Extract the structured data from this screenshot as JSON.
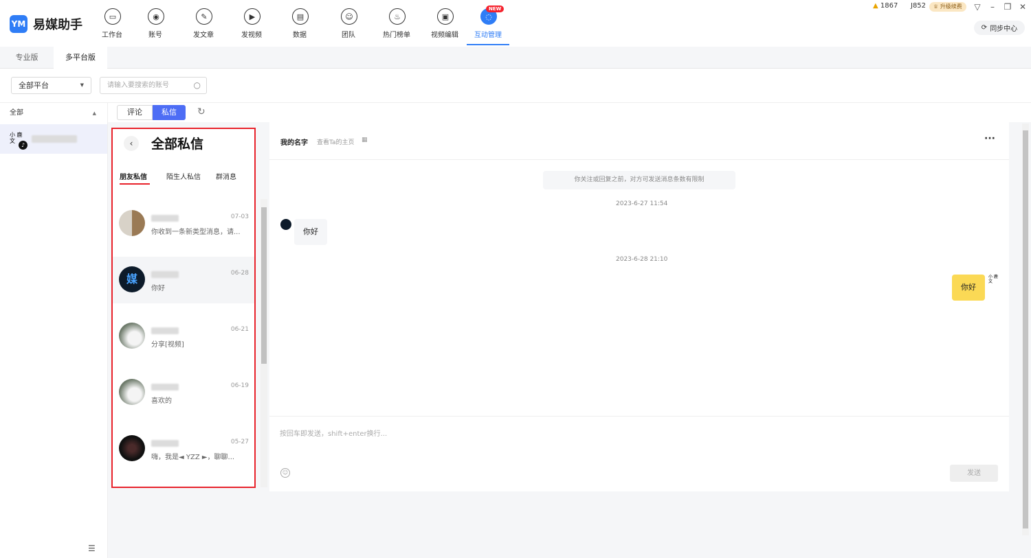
{
  "app": {
    "name": "易媒助手",
    "logo_mark": "YM"
  },
  "nav": [
    {
      "label": "工作台",
      "icon": "monitor-icon",
      "glyph": "▭"
    },
    {
      "label": "账号",
      "icon": "user-icon",
      "glyph": "◉"
    },
    {
      "label": "发文章",
      "icon": "pen-icon",
      "glyph": "✎"
    },
    {
      "label": "发视频",
      "icon": "play-icon",
      "glyph": "▶"
    },
    {
      "label": "数据",
      "icon": "chart-icon",
      "glyph": "▤"
    },
    {
      "label": "团队",
      "icon": "team-icon",
      "glyph": "☺"
    },
    {
      "label": "热门榜单",
      "icon": "fire-icon",
      "glyph": "♨"
    },
    {
      "label": "视频编辑",
      "icon": "briefcase-icon",
      "glyph": "▣"
    },
    {
      "label": "互动管理",
      "icon": "chat-icon",
      "glyph": "◌",
      "badge": "NEW",
      "active": true
    }
  ],
  "top_right": {
    "stat1": "1867",
    "stat2": "J852",
    "upgrade": "升级续费",
    "sync": "同步中心"
  },
  "edition_tabs": [
    "专业版",
    "多平台版"
  ],
  "filters": {
    "platform": "全部平台",
    "search_placeholder": "请输入要搜索的账号"
  },
  "sidebar": {
    "group": "全部",
    "account_avatar_text": "小 鹿 文"
  },
  "subtabs": [
    "评论",
    "私信"
  ],
  "panel": {
    "title": "全部私信",
    "tabs": [
      "朋友私信",
      "陌生人私信",
      "群消息"
    ],
    "conversations": [
      {
        "date": "07-03",
        "preview": "你收到一条新类型消息，请..."
      },
      {
        "date": "06-28",
        "preview": "你好",
        "selected": true
      },
      {
        "date": "06-21",
        "preview": "分享[视频]"
      },
      {
        "date": "06-19",
        "preview": "喜欢的"
      },
      {
        "date": "05-27",
        "preview": "嗨，我是◄ YZZ ►，聊聊..."
      }
    ]
  },
  "chat": {
    "name": "我的名字",
    "home_link": "查看Ta的主页",
    "notice": "你关注或回复之前，对方可发送消息条数有限制",
    "time1": "2023-6-27 11:54",
    "msg_in": "你好",
    "time2": "2023-6-28 21:10",
    "msg_out": "你好",
    "input_placeholder": "按回车即发送，shift+enter换行...",
    "send": "发送"
  }
}
